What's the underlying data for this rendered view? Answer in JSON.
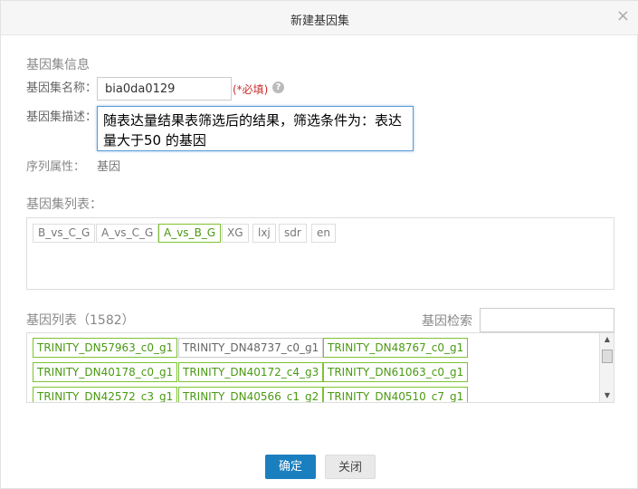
{
  "dialog": {
    "title": "新建基因集",
    "close_glyph": "×"
  },
  "info": {
    "section_title": "基因集信息",
    "name_label": "基因集名称：",
    "name_value": "bia0da0129",
    "required_note": "(*必填)",
    "help_glyph": "?",
    "desc_label": "基因集描述：",
    "desc_value": "随表达量结果表筛选后的结果，筛选条件为：表达量大于50 的基因",
    "attr_label": "序列属性：",
    "attr_value": "基因"
  },
  "gene_sets": {
    "section_title": "基因集列表：",
    "tags": [
      {
        "label": "B_vs_C_G",
        "selected": false
      },
      {
        "label": "A_vs_C_G",
        "selected": false
      },
      {
        "label": "A_vs_B_G",
        "selected": true
      },
      {
        "label": "XG",
        "selected": false
      },
      {
        "label": "lxj",
        "selected": false
      },
      {
        "label": "sdr",
        "selected": false
      },
      {
        "label": "en",
        "selected": false
      }
    ]
  },
  "gene_list": {
    "section_title": "基因列表（1582）",
    "search_label": "基因检索",
    "search_value": "",
    "genes": [
      {
        "id": "TRINITY_DN57963_c0_g1",
        "selected": true
      },
      {
        "id": "TRINITY_DN48737_c0_g1",
        "selected": false
      },
      {
        "id": "TRINITY_DN48767_c0_g1",
        "selected": true
      },
      {
        "id": "TRINITY_DN40178_c0_g1",
        "selected": true
      },
      {
        "id": "TRINITY_DN40172_c4_g3",
        "selected": true
      },
      {
        "id": "TRINITY_DN61063_c0_g1",
        "selected": true
      },
      {
        "id": "TRINITY_DN42572_c3_g1",
        "selected": true
      },
      {
        "id": "TRINITY_DN40566_c1_g2",
        "selected": true
      },
      {
        "id": "TRINITY_DN40510_c7_g1",
        "selected": true
      }
    ],
    "scroll_up_glyph": "▲",
    "scroll_down_glyph": "▼"
  },
  "buttons": {
    "ok": "确定",
    "close": "关闭"
  },
  "colors": {
    "accent": "#1a7fbf",
    "selected_border": "#7dc331",
    "selected_text": "#4a9a12",
    "required": "#c9302c"
  }
}
